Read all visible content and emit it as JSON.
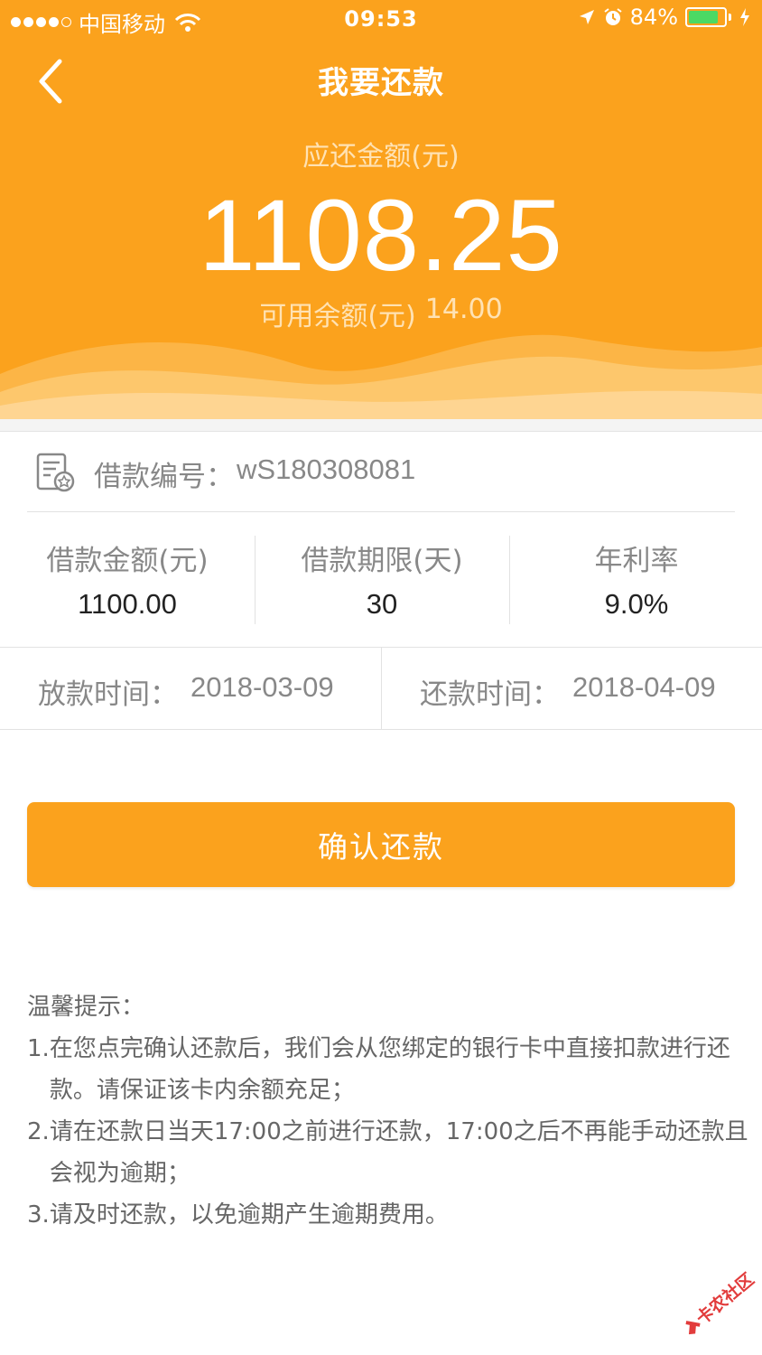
{
  "status_bar": {
    "carrier": "中国移动",
    "time": "09:53",
    "battery_percent": "84%",
    "battery_level": 0.84,
    "battery_color": "#4cd964"
  },
  "nav": {
    "title": "我要还款",
    "back_icon": "chevron-left-icon"
  },
  "summary": {
    "due_label": "应还金额(元)",
    "due_amount": "1108.25",
    "available_label": "可用余额(元)",
    "available_value": "14.00"
  },
  "loan": {
    "id_label": "借款编号：",
    "id_value": "wS180308081",
    "stats": [
      {
        "label": "借款金额(元)",
        "value": "1100.00"
      },
      {
        "label": "借款期限(天)",
        "value": "30"
      },
      {
        "label": "年利率",
        "value": "9.0%"
      }
    ],
    "disburse_label": "放款时间：",
    "disburse_date": "2018-03-09",
    "repay_label": "还款时间：",
    "repay_date": "2018-04-09"
  },
  "actions": {
    "confirm_label": "确认还款"
  },
  "tips": {
    "title": "温馨提示：",
    "items": [
      {
        "num": "1.",
        "text": "在您点完确认还款后，我们会从您绑定的银行卡中直接扣款进行还款。请保证该卡内余额充足；"
      },
      {
        "num": "2.",
        "text": "请在还款日当天17:00之前进行还款，17:00之后不再能手动还款且会视为逾期；"
      },
      {
        "num": "3.",
        "text": "请及时还款，以免逾期产生逾期费用。"
      }
    ]
  },
  "watermark": {
    "text": "卡农社区"
  },
  "colors": {
    "accent": "#fba21d",
    "divider": "#e2e2e2",
    "muted_text": "#888888"
  }
}
